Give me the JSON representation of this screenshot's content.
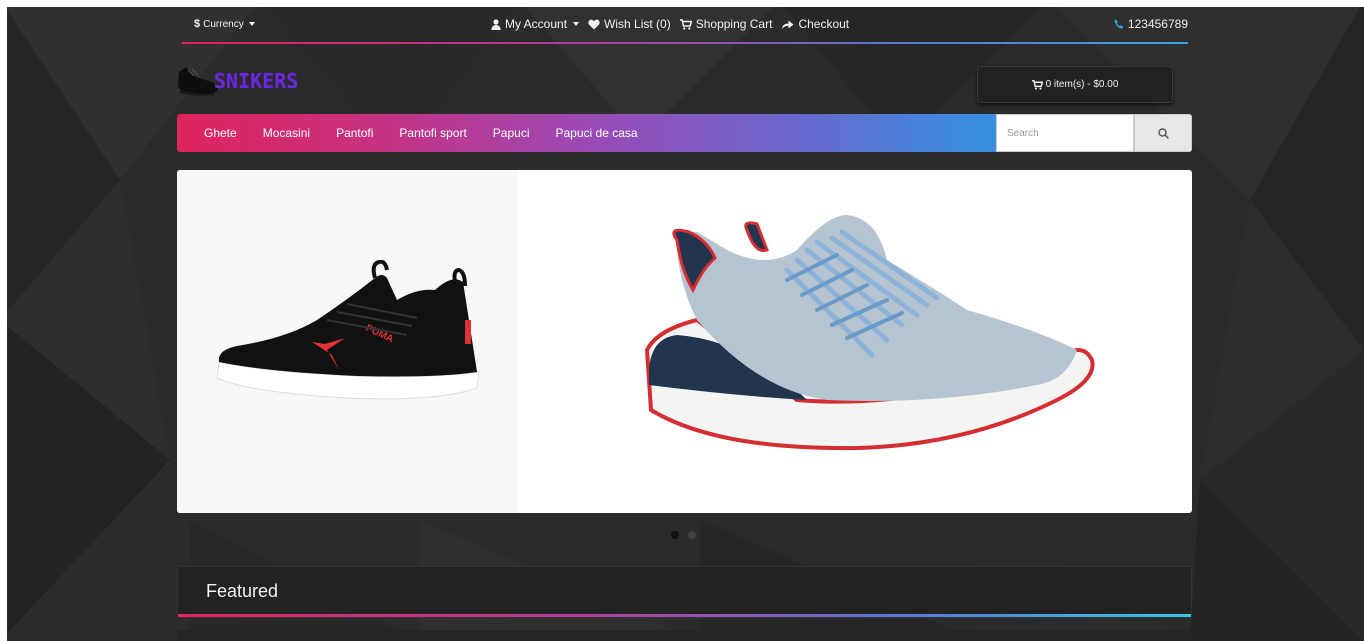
{
  "topbar": {
    "currency_label": "Currency",
    "currency_symbol": "$",
    "my_account": "My Account",
    "wish_list": "Wish List (0)",
    "shopping_cart": "Shopping Cart",
    "checkout": "Checkout",
    "phone": "123456789"
  },
  "logo": {
    "text": "SNIKERS"
  },
  "cart": {
    "label": "0 item(s) - $0.00"
  },
  "menu": {
    "items": [
      "Ghete",
      "Mocasini",
      "Pantofi",
      "Pantofi sport",
      "Papuci",
      "Papuci de casa"
    ]
  },
  "search": {
    "placeholder": "Search"
  },
  "slider": {
    "active_index": 0,
    "count": 2
  },
  "featured": {
    "title": "Featured"
  },
  "colors": {
    "gradient_start": "#e2245f",
    "gradient_mid": "#9c49b4",
    "gradient_end": "#2d9ae3",
    "logo": "#6b2ad8"
  }
}
